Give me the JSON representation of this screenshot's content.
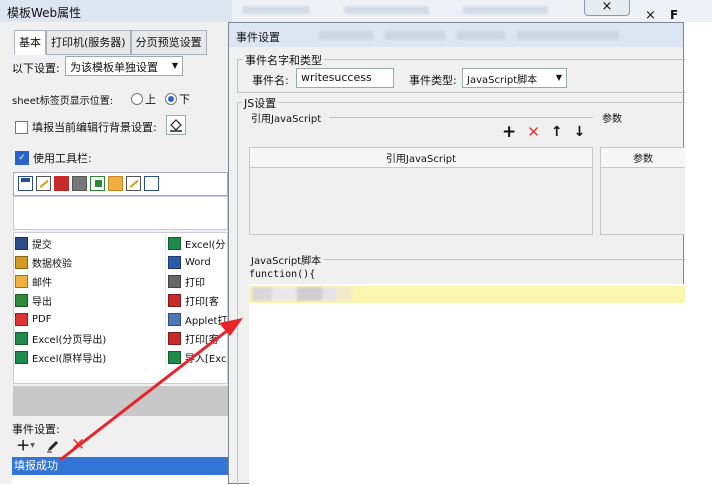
{
  "background_window": {
    "close_label": "×",
    "partial_glyph": "F"
  },
  "left_dialog": {
    "title": "模板Web属性",
    "tabs": [
      "基本",
      "打印机(服务器)",
      "分页预览设置"
    ],
    "settings_label": "以下设置:",
    "settings_value": "为该模板单独设置",
    "sheet_label_pos": "sheet标签页显示位置:",
    "radio_top": "上",
    "radio_bottom": "下",
    "bg_checkbox": "填报当前编辑行背景设置:",
    "use_toolbar": "使用工具栏:",
    "toolbar_items": [
      {
        "label": "提交",
        "icon": "submit-icon"
      },
      {
        "label": "Excel(分",
        "icon": "excel-icon"
      },
      {
        "label": "数据校验",
        "icon": "validate-icon"
      },
      {
        "label": "Word",
        "icon": "word-icon"
      },
      {
        "label": "邮件",
        "icon": "mail-icon"
      },
      {
        "label": "打印",
        "icon": "print-icon"
      },
      {
        "label": "导出",
        "icon": "export-icon"
      },
      {
        "label": "打印[客",
        "icon": "print-client-icon"
      },
      {
        "label": "PDF",
        "icon": "pdf-icon"
      },
      {
        "label": "Applet打",
        "icon": "applet-icon"
      },
      {
        "label": "Excel(分页导出)",
        "icon": "excel-icon"
      },
      {
        "label": "打印[客",
        "icon": "print-client-icon"
      },
      {
        "label": "Excel(原样导出)",
        "icon": "excel-icon"
      },
      {
        "label": "导入[Exc",
        "icon": "import-excel-icon"
      }
    ],
    "event_settings": "事件设置:",
    "event_selected": "填报成功"
  },
  "right_dialog": {
    "title": "事件设置",
    "name_type_group": "事件名字和类型",
    "event_name_label": "事件名:",
    "event_name_value": "writesuccess",
    "event_type_label": "事件类型:",
    "event_type_value": "JavaScript脚本",
    "js_group": "JS设置",
    "ref_js_label": "引用JavaScript",
    "params_label": "参数",
    "ref_js_header": "引用JavaScript",
    "params_header": "参数",
    "script_group": "JavaScript脚本",
    "code_line1": "function(){"
  },
  "colors": {
    "title_bar": "#dce6f2",
    "selection": "#3375d6",
    "highlight_line": "#fbf7b0",
    "arrow": "#e8232a",
    "delete_red": "#e23a3a"
  }
}
